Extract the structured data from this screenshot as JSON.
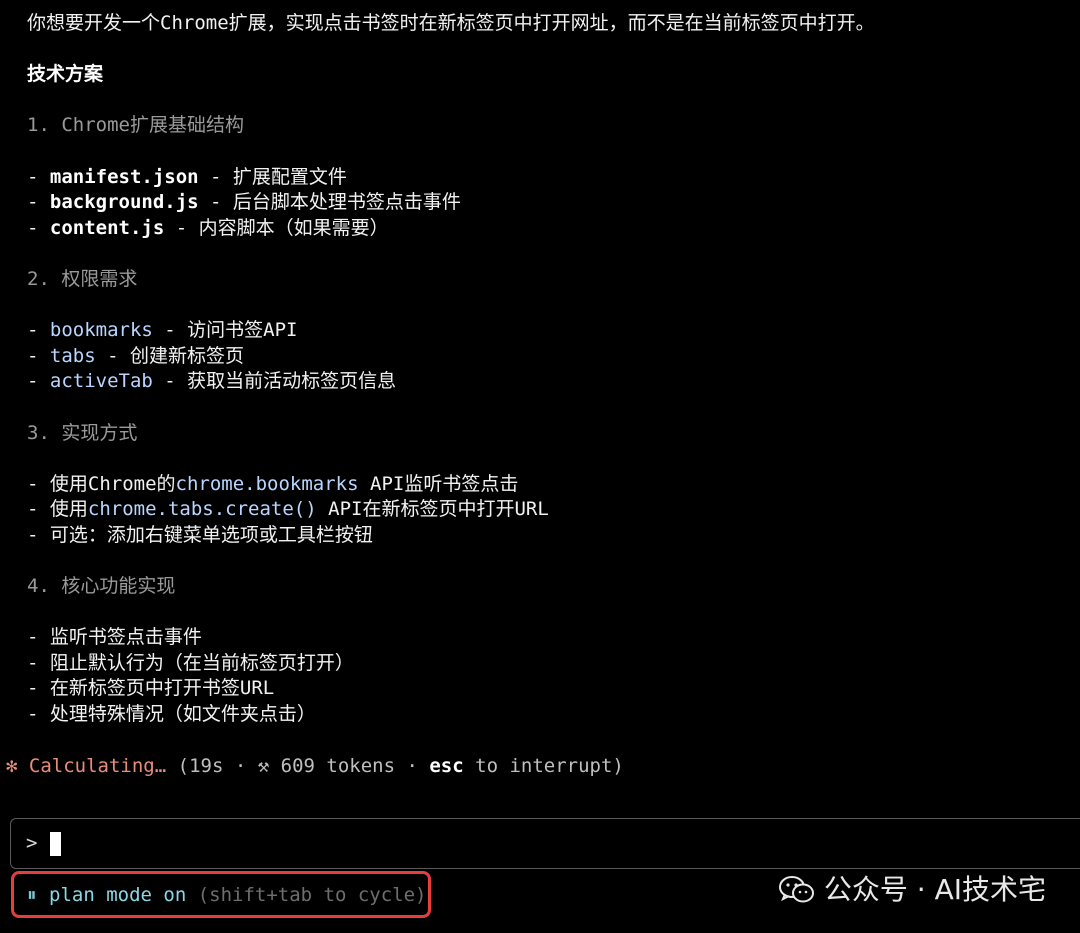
{
  "terminal": {
    "intro": "你想要开发一个Chrome扩展，实现点击书签时在新标签页中打开网址，而不是在当前标签页中打开。",
    "heading": "技术方案",
    "sections": [
      {
        "title": "1. Chrome扩展基础结构",
        "items": [
          {
            "bullet": "- ",
            "name": "manifest.json",
            "rest": " - 扩展配置文件"
          },
          {
            "bullet": "- ",
            "name": "background.js",
            "rest": " - 后台脚本处理书签点击事件"
          },
          {
            "bullet": "- ",
            "name": "content.js",
            "rest": " - 内容脚本（如果需要）"
          }
        ]
      },
      {
        "title": "2. 权限需求",
        "items": [
          {
            "bullet": "- ",
            "name": "bookmarks",
            "rest": " - 访问书签API"
          },
          {
            "bullet": "- ",
            "name": "tabs",
            "rest": " - 创建新标签页"
          },
          {
            "bullet": "- ",
            "name": "activeTab",
            "rest": " - 获取当前活动标签页信息"
          }
        ]
      },
      {
        "title": "3. 实现方式",
        "items": [
          {
            "bullet": "- ",
            "prefix": "使用Chrome的",
            "code": "chrome.bookmarks",
            "suffix": " API监听书签点击"
          },
          {
            "bullet": "- ",
            "prefix": "使用",
            "code": "chrome.tabs.create()",
            "suffix": " API在新标签页中打开URL"
          },
          {
            "bullet": "- ",
            "text": "可选：添加右键菜单选项或工具栏按钮"
          }
        ]
      },
      {
        "title": "4. 核心功能实现",
        "items": [
          {
            "bullet": "- ",
            "text": "监听书签点击事件"
          },
          {
            "bullet": "- ",
            "text": "阻止默认行为（在当前标签页打开）"
          },
          {
            "bullet": "- ",
            "text": "在新标签页中打开书签URL"
          },
          {
            "bullet": "- ",
            "text": "处理特殊情况（如文件夹点击）"
          }
        ]
      }
    ]
  },
  "status": {
    "star": "✻",
    "calculating": "Calculating…",
    "open_paren": " (",
    "elapsed": "19s",
    "sep1": " · ",
    "tokens_icon": "⚒",
    "tokens": " 609 tokens",
    "sep2": " · ",
    "esc": "esc",
    "interrupt": " to interrupt)"
  },
  "prompt": {
    "symbol": ">",
    "value": ""
  },
  "mode": {
    "icon": "⏸",
    "label": "plan mode on",
    "hint": " (shift+tab to cycle)"
  },
  "watermark": {
    "text": "公众号 · AI技术宅",
    "icon": "wechat-icon"
  },
  "colors": {
    "background": "#000000",
    "accent_status": "#e98d7b",
    "code_blue": "#b9d6ff",
    "mode_cyan": "#8bd7e6",
    "highlight_red": "#e63d3d"
  }
}
